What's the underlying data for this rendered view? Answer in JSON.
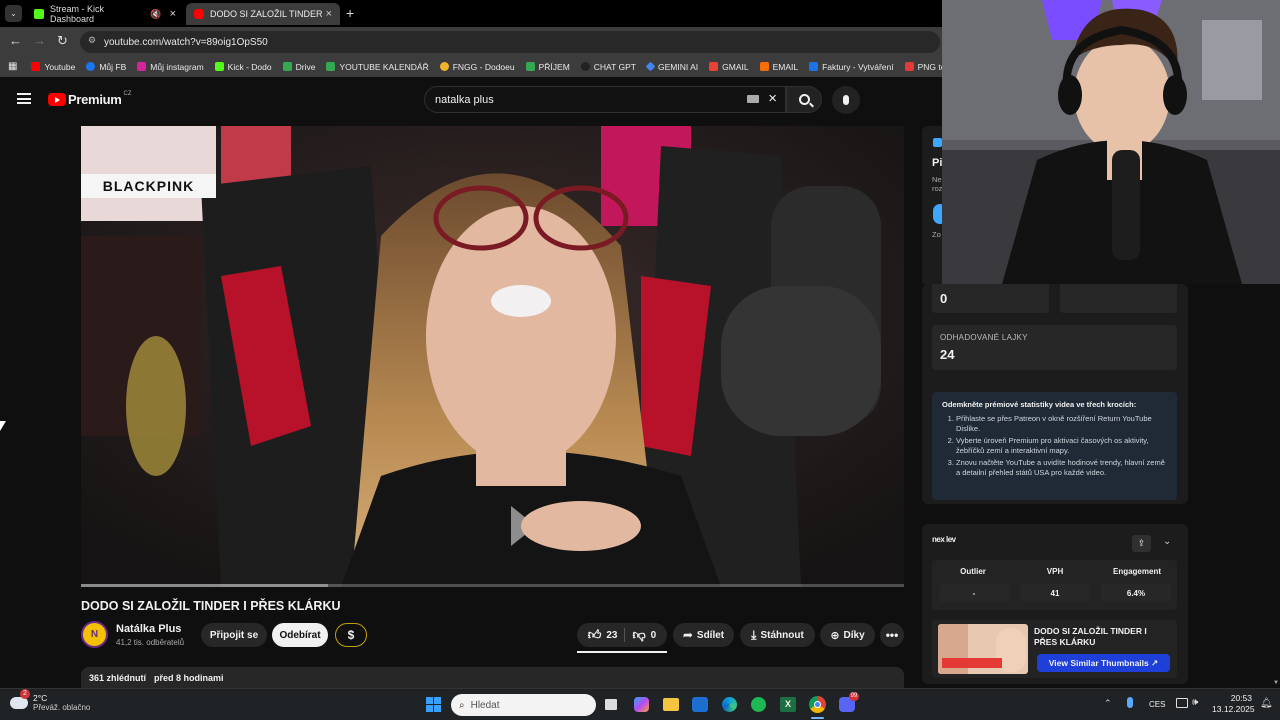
{
  "tabs": [
    {
      "label": "Stream - Kick Dashboard",
      "accent": "#53fc18"
    },
    {
      "label": "DODO SI ZALOŽIL TINDER I PŘE",
      "accent": "#ff0000"
    }
  ],
  "address": {
    "url": "youtube.com/watch?v=89oig1OpS50"
  },
  "bookmarks": [
    {
      "label": "Youtube",
      "color": "#ff0000"
    },
    {
      "label": "Můj FB",
      "color": "#1877f2"
    },
    {
      "label": "Můj instagram",
      "color": "#d6249f"
    },
    {
      "label": "Kick - Dodo",
      "color": "#53fc18"
    },
    {
      "label": "Drive",
      "color": "#34a853"
    },
    {
      "label": "YOUTUBE KALENDÁŘ",
      "color": "#34a853"
    },
    {
      "label": "FNGG - Dodoeu",
      "color": "#f0b429"
    },
    {
      "label": "PŘÍJEM",
      "color": "#34a853"
    },
    {
      "label": "CHAT GPT",
      "color": "#222222"
    },
    {
      "label": "GEMINI AI",
      "color": "#4285f4"
    },
    {
      "label": "GMAIL",
      "color": "#ea4335"
    },
    {
      "label": "EMAIL",
      "color": "#ff6d00"
    },
    {
      "label": "Faktury - Vytváření",
      "color": "#1a73e8"
    },
    {
      "label": "PNG to",
      "color": "#e53935"
    }
  ],
  "header": {
    "logo_text": "Premium",
    "region": "CZ",
    "search_value": "natalka plus"
  },
  "video": {
    "title": "DODO SI ZALOŽIL TINDER I PŘES KLÁRKU",
    "channel_name": "Natálka Plus",
    "subscribers": "41,2 tis. odběratelů",
    "join_label": "Připojit se",
    "subscribe_label": "Odebírat",
    "dollar_label": "$",
    "likes": "23",
    "dislikes": "0",
    "share_label": "Sdílet",
    "download_label": "Stáhnout",
    "thanks_label": "Díky",
    "views": "361 zhlédnutí",
    "uploaded": "před 8 hodinami",
    "overlay_text": "BLACKPINK"
  },
  "sidepanel": {
    "partial_letter": "Pi",
    "partial_lines": [
      "Ne",
      "roz",
      "Zo"
    ],
    "stat_value": "0",
    "likes_label": "ODHADOVANÉ LAJKY",
    "likes_value": "24",
    "premium": {
      "heading": "Odemkněte prémiové statistiky videa ve třech krocích:",
      "steps": [
        "Přihlaste se přes Patreon v okně rozšíření Return YouTube Dislike.",
        "Vyberte úroveň Premium pro aktivaci časových os aktivity, žebříčků zemí a interaktivní mapy.",
        "Znovu načtěte YouTube a uvidíte hodinové trendy, hlavní země a detailní přehled států USA pro každé video."
      ]
    },
    "nexlev": {
      "logo": "nex lev",
      "headers": [
        "Outlier",
        "VPH",
        "Engagement"
      ],
      "values": [
        "-",
        "41",
        "6.4%"
      ],
      "thumb_title": "DODO SI ZALOŽIL TINDER I PŘES KLÁRKU",
      "similar_label": "View Similar Thumbnails ↗"
    }
  },
  "taskbar": {
    "weather_temp": "2°C",
    "weather_desc": "Převáž. oblačno",
    "weather_badge": "2",
    "search_placeholder": "Hledat",
    "lang": "CES",
    "time": "20:53",
    "date": "13.12.2025",
    "discord_badge": "99"
  },
  "colors": {
    "yt_red": "#ff0000",
    "accent_blue": "#3ea6ff",
    "nexlev_blue": "#1e3fd8"
  }
}
